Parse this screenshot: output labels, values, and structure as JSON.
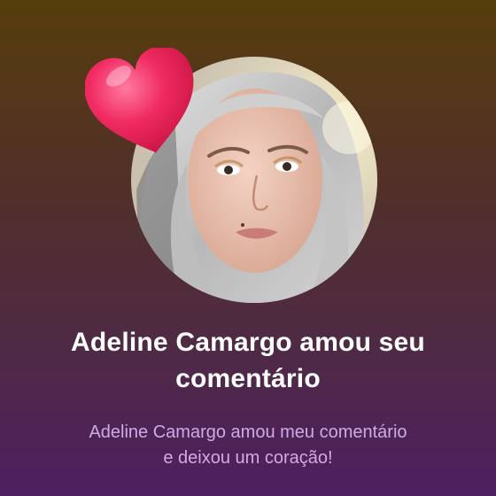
{
  "notification": {
    "title_line1": "Adeline Camargo amou seu",
    "title_line2": "comentário",
    "subtitle_line1": "Adeline Camargo amou meu comentário",
    "subtitle_line2": "e deixou um coração!"
  },
  "icons": {
    "reaction": "heart-icon"
  },
  "colors": {
    "background_top": "#563d0b",
    "background_bottom": "#4e1f60",
    "title": "#ffffff",
    "subtitle": "#d2a9e6",
    "heart": "#f0245e"
  }
}
